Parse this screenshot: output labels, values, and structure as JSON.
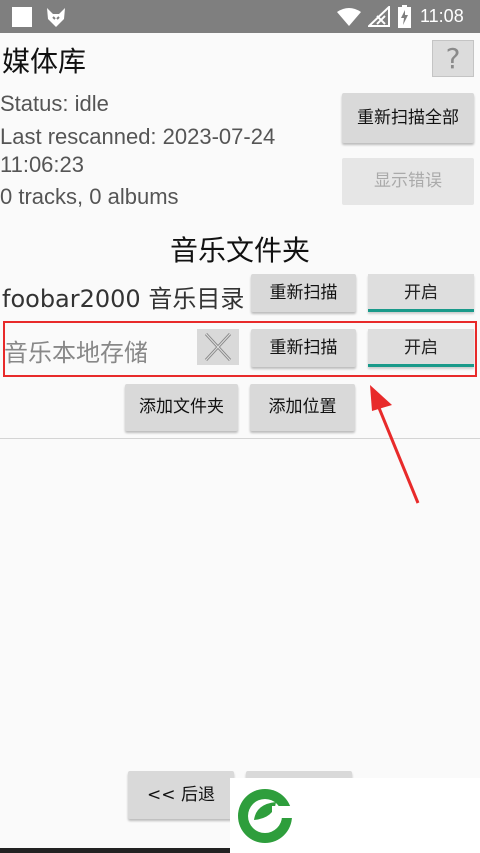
{
  "status_bar": {
    "time": "11:08"
  },
  "header": {
    "title": "媒体库",
    "help_label": "?"
  },
  "info": {
    "status": "Status: idle",
    "rescanned_line1": "Last rescanned: 2023-07-24",
    "rescanned_line2": "11:06:23",
    "counts": "0 tracks, 0 albums"
  },
  "buttons": {
    "rescan_all": "重新扫描全部",
    "show_errors": "显示错误",
    "add_folder": "添加文件夹",
    "add_location": "添加位置",
    "back": "<< 后退"
  },
  "music_folders": {
    "heading": "音乐文件夹",
    "items": [
      {
        "name": "foobar2000 音乐目录",
        "rescan": "重新扫描",
        "toggle": "开启"
      },
      {
        "name": "音乐本地存储",
        "rescan": "重新扫描",
        "toggle": "开启"
      }
    ]
  },
  "colors": {
    "toggle_accent": "#1a9a8a",
    "highlight": "#e82a2a",
    "logo_green": "#2e9e3c"
  }
}
